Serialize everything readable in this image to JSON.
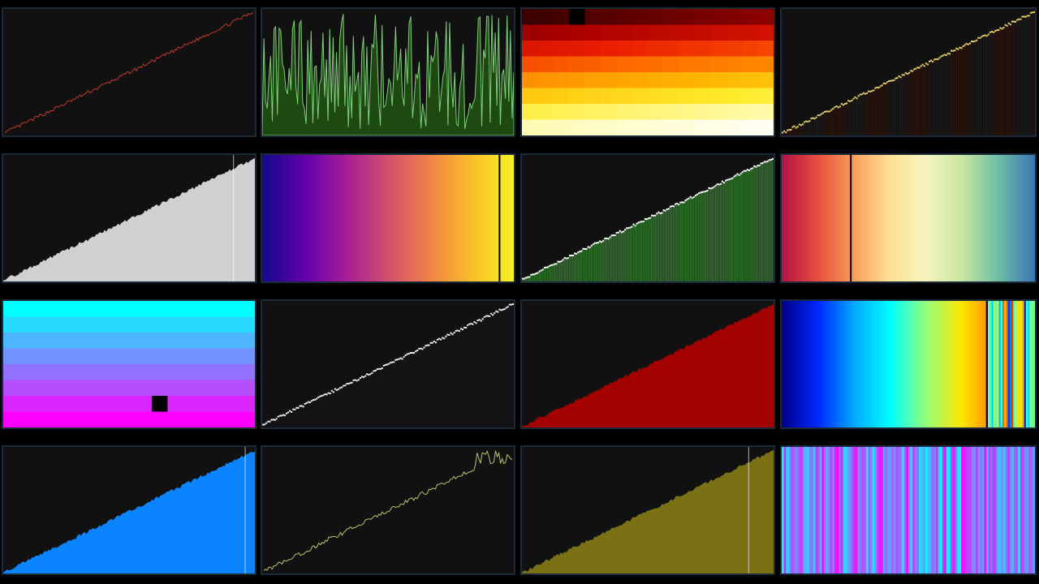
{
  "screen": {
    "background": "#000000",
    "panel_border": "#1b2a38",
    "panel_bg": "#111111"
  },
  "panels": [
    {
      "name": "sort-red-line",
      "style": "line",
      "color": "#c0392b",
      "bar_count": 150,
      "highlight_index": 149
    },
    {
      "name": "sort-green-oscillation",
      "style": "oscillation",
      "color": "#7fd07a",
      "fill": "#1e4a12",
      "bar_count": 150
    },
    {
      "name": "sort-heat-grid",
      "style": "heatgrid",
      "rows": 8,
      "cols": 16,
      "colormap": "hot",
      "highlight_row": 0,
      "highlight_col": 3
    },
    {
      "name": "sort-yellow-dots",
      "style": "dots",
      "color": "#e6d16a",
      "line": "#3a1a10",
      "bar_count": 150
    },
    {
      "name": "sort-gray-area",
      "style": "area",
      "color": "#d0d0d0",
      "bar_count": 150,
      "highlight_index": 136
    },
    {
      "name": "sort-plasma-gradient",
      "style": "gradient",
      "colormap": "plasma",
      "highlight_fraction": 0.94
    },
    {
      "name": "sort-green-bars-dots",
      "style": "bars-dots",
      "color": "#2f6e2a",
      "dot": "#ffffff",
      "bar_count": 150
    },
    {
      "name": "sort-spectral-gradient",
      "style": "gradient",
      "colormap": "spectral",
      "highlight_fraction": 0.27
    },
    {
      "name": "sort-cool-grid",
      "style": "coolgrid",
      "rows": 8,
      "colormap": "cool",
      "highlight_row": 6,
      "highlight_fraction": 0.59
    },
    {
      "name": "sort-white-dots",
      "style": "dots",
      "color": "#f0f0f0",
      "line": "#1a1a1a",
      "bar_count": 150
    },
    {
      "name": "sort-red-area",
      "style": "area",
      "color": "#a30000",
      "bar_count": 150
    },
    {
      "name": "sort-jet-gradient",
      "style": "jet-shuffled",
      "colormap": "jet",
      "sorted_fraction": 0.81
    },
    {
      "name": "sort-blue-area",
      "style": "area",
      "color": "#0a84ff",
      "bar_count": 150,
      "highlight_index": 143
    },
    {
      "name": "sort-olive-line",
      "style": "line-noisy",
      "color": "#b6c46a",
      "bar_count": 150
    },
    {
      "name": "sort-olive-area",
      "style": "area",
      "color": "#7a7014",
      "bar_count": 150,
      "highlight_index": 134
    },
    {
      "name": "sort-cool-stripes",
      "style": "stripes",
      "colormap": "cool",
      "bar_count": 120
    }
  ]
}
